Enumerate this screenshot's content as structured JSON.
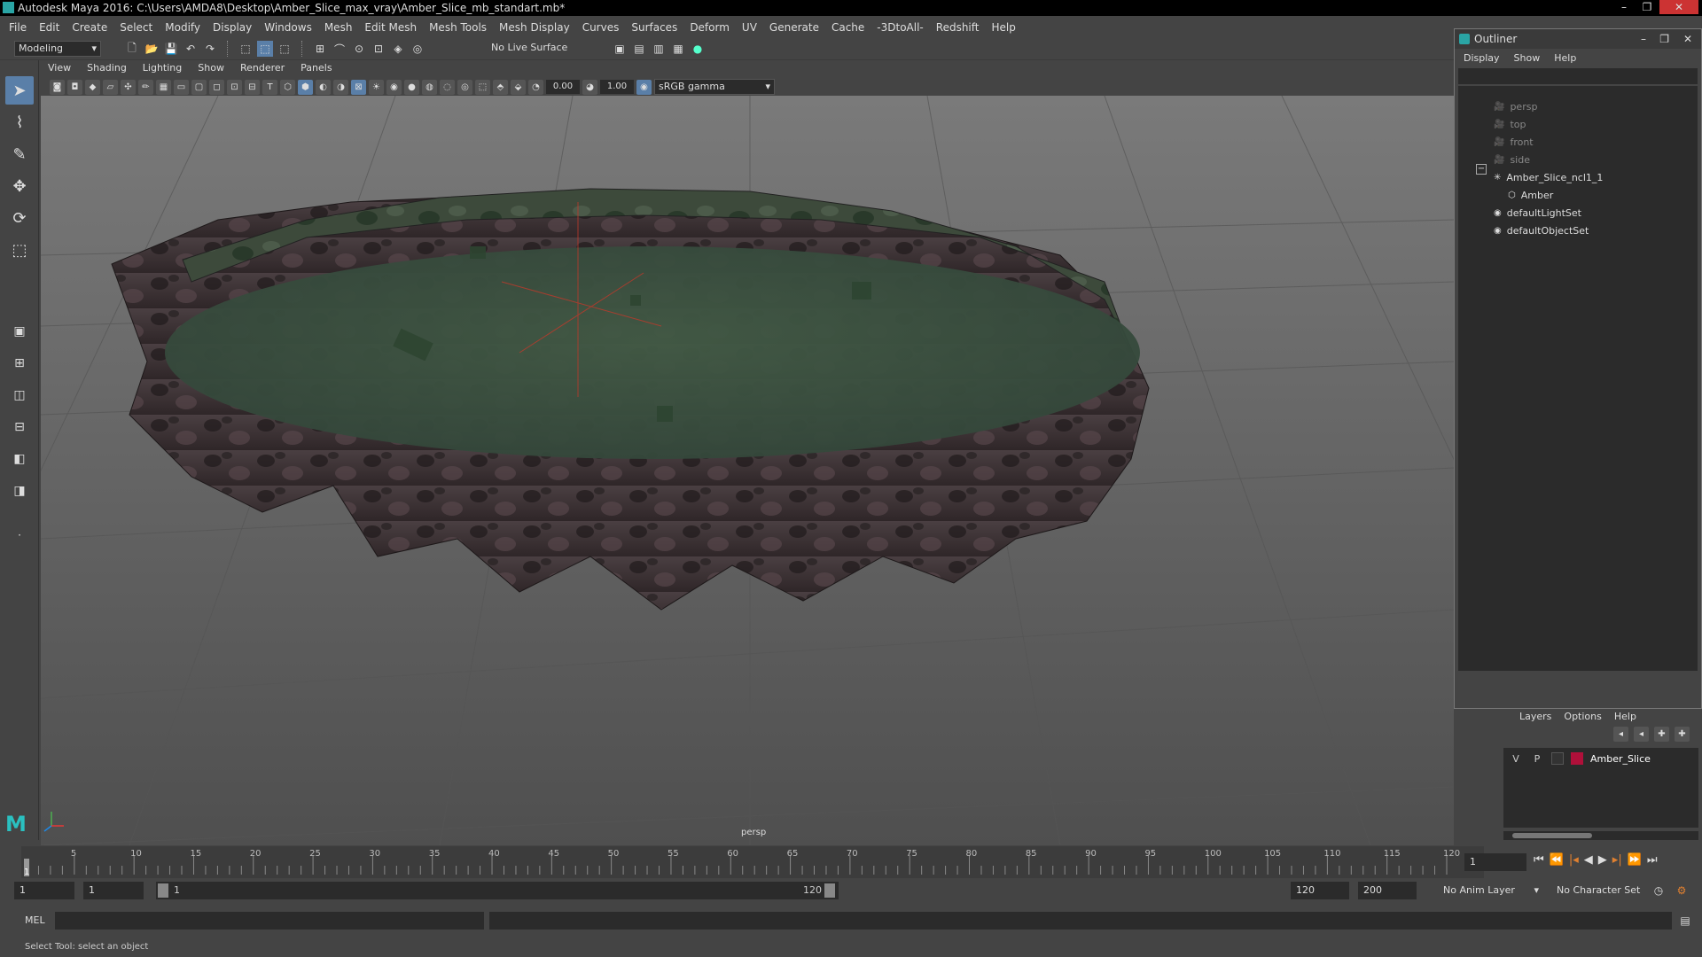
{
  "window": {
    "title": "Autodesk Maya 2016: C:\\Users\\AMDA8\\Desktop\\Amber_Slice_max_vray\\Amber_Slice_mb_standart.mb*",
    "minimize": "–",
    "maximize": "❐",
    "close": "✕"
  },
  "menubar": [
    "File",
    "Edit",
    "Create",
    "Select",
    "Modify",
    "Display",
    "Windows",
    "Mesh",
    "Edit Mesh",
    "Mesh Tools",
    "Mesh Display",
    "Curves",
    "Surfaces",
    "Deform",
    "UV",
    "Generate",
    "Cache",
    "-3DtoAll-",
    "Redshift",
    "Help"
  ],
  "shelf": {
    "mode": "Modeling",
    "live_surface": "No Live Surface"
  },
  "viewport": {
    "menu": [
      "View",
      "Shading",
      "Lighting",
      "Show",
      "Renderer",
      "Panels"
    ],
    "exposure": "0.00",
    "gamma": "1.00",
    "color_space": "sRGB gamma",
    "camera_label": "persp"
  },
  "outliner": {
    "title": "Outliner",
    "menu": [
      "Display",
      "Show",
      "Help"
    ],
    "items": [
      {
        "label": "persp",
        "icon": "camera-icon",
        "dim": true
      },
      {
        "label": "top",
        "icon": "camera-icon",
        "dim": true
      },
      {
        "label": "front",
        "icon": "camera-icon",
        "dim": true
      },
      {
        "label": "side",
        "icon": "camera-icon",
        "dim": true
      },
      {
        "label": "Amber_Slice_ncl1_1",
        "icon": "group-icon",
        "dim": false
      },
      {
        "label": "Amber",
        "icon": "mesh-icon",
        "dim": false
      },
      {
        "label": "defaultLightSet",
        "icon": "set-icon",
        "dim": false
      },
      {
        "label": "defaultObjectSet",
        "icon": "set-icon",
        "dim": false
      }
    ]
  },
  "layers": {
    "menu": [
      "Layers",
      "Options",
      "Help"
    ],
    "row": {
      "v": "V",
      "p": "P",
      "name": "Amber_Slice",
      "color": "#b0103a"
    }
  },
  "timeline": {
    "ticks": [
      "5",
      "10",
      "15",
      "20",
      "25",
      "30",
      "35",
      "40",
      "45",
      "50",
      "55",
      "60",
      "65",
      "70",
      "75",
      "80",
      "85",
      "90",
      "95",
      "100",
      "105",
      "110",
      "115",
      "120"
    ],
    "current_frame": "1",
    "start_marker": "1"
  },
  "range": {
    "start": "1",
    "anim_start": "1",
    "slider_start": "1",
    "slider_end": "120",
    "end": "120",
    "anim_end": "200",
    "anim_layer": "No Anim Layer",
    "character_set": "No Character Set"
  },
  "command": {
    "label": "MEL"
  },
  "help_line": "Select Tool: select an object"
}
